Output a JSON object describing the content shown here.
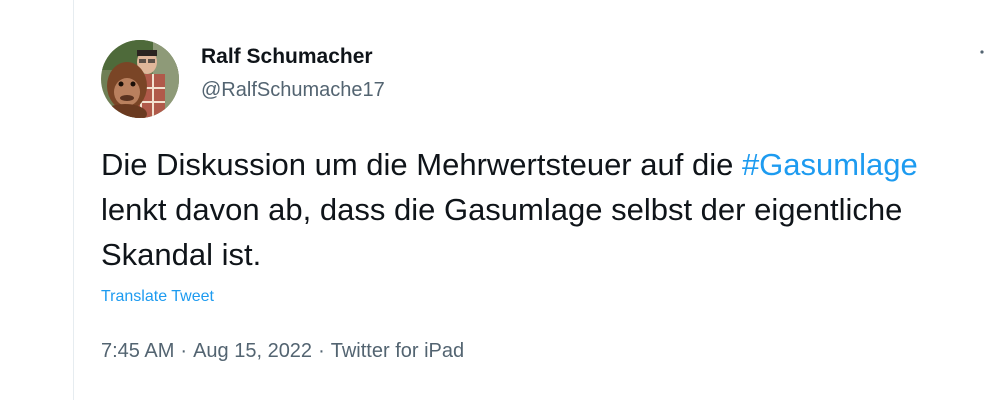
{
  "author": {
    "name": "Ralf Schumacher",
    "handle": "@RalfSchumache17"
  },
  "tweet": {
    "text_before_hashtag": "Die Diskussion um die Mehrwertsteuer auf die ",
    "hashtag": "#Gasumlage",
    "text_after_hashtag": " lenkt davon ab, dass die Gasumlage selbst der eigentliche Skandal ist."
  },
  "translate_label": "Translate Tweet",
  "meta": {
    "time": "7:45 AM",
    "separator": "·",
    "date": "Aug 15, 2022",
    "source": "Twitter for iPad"
  },
  "colors": {
    "link": "#1d9bf0",
    "secondary_text": "#536471",
    "primary_text": "#0f1419"
  },
  "icons": {
    "more": "more-dots-icon",
    "avatar": "profile-photo"
  }
}
